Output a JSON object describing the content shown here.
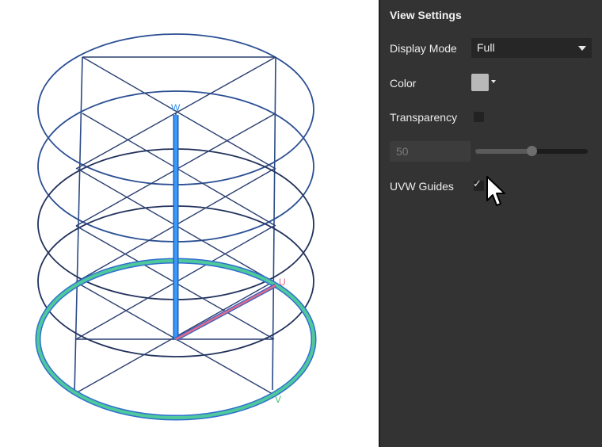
{
  "panel": {
    "title": "View Settings",
    "display_mode": {
      "label": "Display Mode",
      "value": "Full"
    },
    "color": {
      "label": "Color",
      "value": "#b8b8b8"
    },
    "transparency": {
      "label": "Transparency",
      "checked": false
    },
    "opacity": {
      "value": "50",
      "slider_percent": 50
    },
    "uvw_guides": {
      "label": "UVW Guides",
      "checked": true
    }
  },
  "viewport": {
    "axis_labels": {
      "w": "W",
      "u": "U",
      "v": "V"
    },
    "colors": {
      "w_axis": "#2f8ff0",
      "u_axis": "#e06b8b",
      "base_ring": "#4fc99b",
      "outline": "#2a4a86"
    }
  }
}
